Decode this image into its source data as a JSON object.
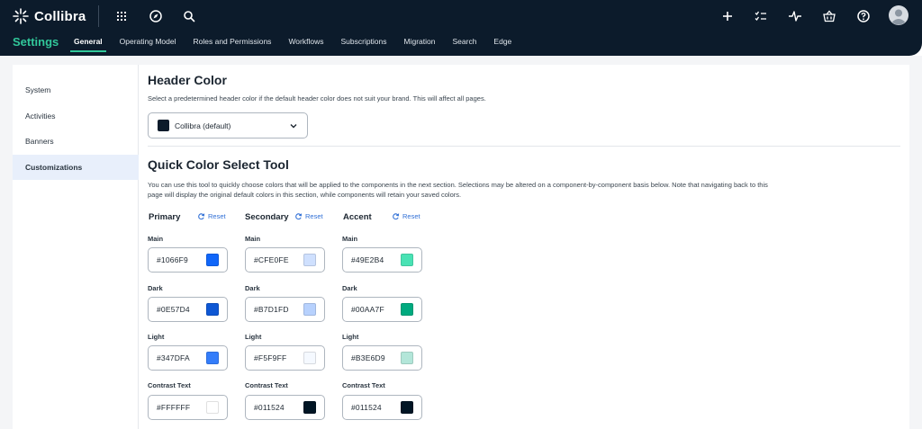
{
  "app": {
    "brand": "Collibra",
    "section_title": "Settings",
    "nav_tabs": [
      "General",
      "Operating Model",
      "Roles and Permissions",
      "Workflows",
      "Subscriptions",
      "Migration",
      "Search",
      "Edge"
    ],
    "active_tab": "General",
    "icons_left": [
      "apps-grid-icon",
      "compass-icon",
      "search-icon"
    ],
    "icons_right": [
      "plus-icon",
      "task-list-icon",
      "activity-icon",
      "basket-icon",
      "help-icon",
      "user-avatar-icon"
    ]
  },
  "sidebar": {
    "items": [
      {
        "label": "System"
      },
      {
        "label": "Activities"
      },
      {
        "label": "Banners"
      },
      {
        "label": "Customizations"
      }
    ],
    "active": "Customizations"
  },
  "header_color": {
    "title": "Header Color",
    "description": "Select a predetermined header color if the default header color does not suit your brand. This will affect all pages.",
    "selected_label": "Collibra (default)",
    "selected_color": "#0c1b2b"
  },
  "quick_color": {
    "title": "Quick Color Select Tool",
    "description_line1": "You can use this tool to quickly choose colors that will be applied to the components in the next section. Selections may be altered on a component-by-component basis below. Note that navigating back to this",
    "description_line2": "page will display the original default colors in this section, while components will retain your saved colors.",
    "reset_label": "Reset",
    "row_labels": {
      "main": "Main",
      "dark": "Dark",
      "light": "Light",
      "contrast": "Contrast Text"
    },
    "columns": [
      {
        "name": "Primary",
        "main": "#1066F9",
        "dark": "#0E57D4",
        "light": "#347DFA",
        "contrast": "#FFFFFF"
      },
      {
        "name": "Secondary",
        "main": "#CFE0FE",
        "dark": "#B7D1FD",
        "light": "#F5F9FF",
        "contrast": "#011524"
      },
      {
        "name": "Accent",
        "main": "#49E2B4",
        "dark": "#00AA7F",
        "light": "#B3E6D9",
        "contrast": "#011524"
      }
    ]
  },
  "colors": {
    "header_bg": "#0c1b2b",
    "accent_green": "#31c79a",
    "link_blue": "#2f6fd6"
  }
}
